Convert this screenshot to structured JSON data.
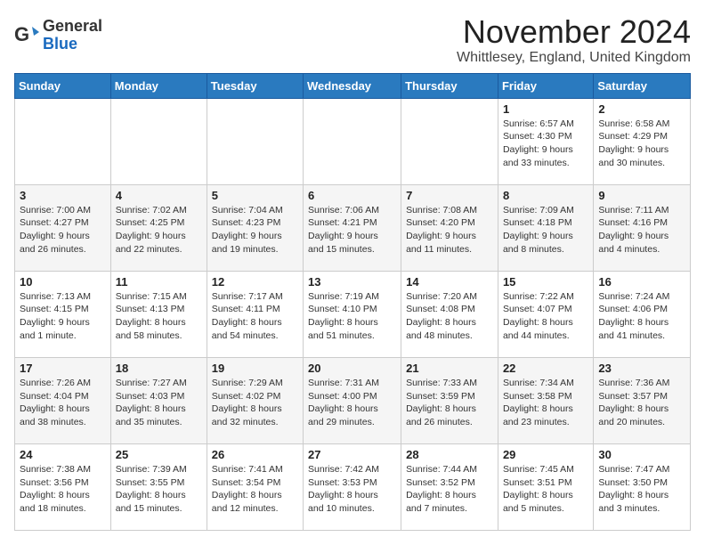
{
  "logo": {
    "general": "General",
    "blue": "Blue"
  },
  "title": "November 2024",
  "location": "Whittlesey, England, United Kingdom",
  "days_of_week": [
    "Sunday",
    "Monday",
    "Tuesday",
    "Wednesday",
    "Thursday",
    "Friday",
    "Saturday"
  ],
  "weeks": [
    [
      {
        "day": "",
        "info": ""
      },
      {
        "day": "",
        "info": ""
      },
      {
        "day": "",
        "info": ""
      },
      {
        "day": "",
        "info": ""
      },
      {
        "day": "",
        "info": ""
      },
      {
        "day": "1",
        "info": "Sunrise: 6:57 AM\nSunset: 4:30 PM\nDaylight: 9 hours and 33 minutes."
      },
      {
        "day": "2",
        "info": "Sunrise: 6:58 AM\nSunset: 4:29 PM\nDaylight: 9 hours and 30 minutes."
      }
    ],
    [
      {
        "day": "3",
        "info": "Sunrise: 7:00 AM\nSunset: 4:27 PM\nDaylight: 9 hours and 26 minutes."
      },
      {
        "day": "4",
        "info": "Sunrise: 7:02 AM\nSunset: 4:25 PM\nDaylight: 9 hours and 22 minutes."
      },
      {
        "day": "5",
        "info": "Sunrise: 7:04 AM\nSunset: 4:23 PM\nDaylight: 9 hours and 19 minutes."
      },
      {
        "day": "6",
        "info": "Sunrise: 7:06 AM\nSunset: 4:21 PM\nDaylight: 9 hours and 15 minutes."
      },
      {
        "day": "7",
        "info": "Sunrise: 7:08 AM\nSunset: 4:20 PM\nDaylight: 9 hours and 11 minutes."
      },
      {
        "day": "8",
        "info": "Sunrise: 7:09 AM\nSunset: 4:18 PM\nDaylight: 9 hours and 8 minutes."
      },
      {
        "day": "9",
        "info": "Sunrise: 7:11 AM\nSunset: 4:16 PM\nDaylight: 9 hours and 4 minutes."
      }
    ],
    [
      {
        "day": "10",
        "info": "Sunrise: 7:13 AM\nSunset: 4:15 PM\nDaylight: 9 hours and 1 minute."
      },
      {
        "day": "11",
        "info": "Sunrise: 7:15 AM\nSunset: 4:13 PM\nDaylight: 8 hours and 58 minutes."
      },
      {
        "day": "12",
        "info": "Sunrise: 7:17 AM\nSunset: 4:11 PM\nDaylight: 8 hours and 54 minutes."
      },
      {
        "day": "13",
        "info": "Sunrise: 7:19 AM\nSunset: 4:10 PM\nDaylight: 8 hours and 51 minutes."
      },
      {
        "day": "14",
        "info": "Sunrise: 7:20 AM\nSunset: 4:08 PM\nDaylight: 8 hours and 48 minutes."
      },
      {
        "day": "15",
        "info": "Sunrise: 7:22 AM\nSunset: 4:07 PM\nDaylight: 8 hours and 44 minutes."
      },
      {
        "day": "16",
        "info": "Sunrise: 7:24 AM\nSunset: 4:06 PM\nDaylight: 8 hours and 41 minutes."
      }
    ],
    [
      {
        "day": "17",
        "info": "Sunrise: 7:26 AM\nSunset: 4:04 PM\nDaylight: 8 hours and 38 minutes."
      },
      {
        "day": "18",
        "info": "Sunrise: 7:27 AM\nSunset: 4:03 PM\nDaylight: 8 hours and 35 minutes."
      },
      {
        "day": "19",
        "info": "Sunrise: 7:29 AM\nSunset: 4:02 PM\nDaylight: 8 hours and 32 minutes."
      },
      {
        "day": "20",
        "info": "Sunrise: 7:31 AM\nSunset: 4:00 PM\nDaylight: 8 hours and 29 minutes."
      },
      {
        "day": "21",
        "info": "Sunrise: 7:33 AM\nSunset: 3:59 PM\nDaylight: 8 hours and 26 minutes."
      },
      {
        "day": "22",
        "info": "Sunrise: 7:34 AM\nSunset: 3:58 PM\nDaylight: 8 hours and 23 minutes."
      },
      {
        "day": "23",
        "info": "Sunrise: 7:36 AM\nSunset: 3:57 PM\nDaylight: 8 hours and 20 minutes."
      }
    ],
    [
      {
        "day": "24",
        "info": "Sunrise: 7:38 AM\nSunset: 3:56 PM\nDaylight: 8 hours and 18 minutes."
      },
      {
        "day": "25",
        "info": "Sunrise: 7:39 AM\nSunset: 3:55 PM\nDaylight: 8 hours and 15 minutes."
      },
      {
        "day": "26",
        "info": "Sunrise: 7:41 AM\nSunset: 3:54 PM\nDaylight: 8 hours and 12 minutes."
      },
      {
        "day": "27",
        "info": "Sunrise: 7:42 AM\nSunset: 3:53 PM\nDaylight: 8 hours and 10 minutes."
      },
      {
        "day": "28",
        "info": "Sunrise: 7:44 AM\nSunset: 3:52 PM\nDaylight: 8 hours and 7 minutes."
      },
      {
        "day": "29",
        "info": "Sunrise: 7:45 AM\nSunset: 3:51 PM\nDaylight: 8 hours and 5 minutes."
      },
      {
        "day": "30",
        "info": "Sunrise: 7:47 AM\nSunset: 3:50 PM\nDaylight: 8 hours and 3 minutes."
      }
    ]
  ]
}
